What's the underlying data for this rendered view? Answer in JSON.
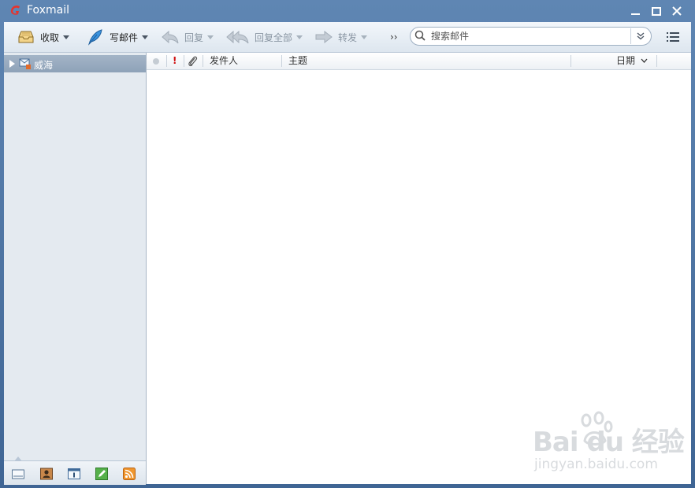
{
  "window": {
    "title": "Foxmail"
  },
  "toolbar": {
    "receive_label": "收取",
    "compose_label": "写邮件",
    "reply_label": "回复",
    "reply_all_label": "回复全部",
    "forward_label": "转发",
    "more_label": "››",
    "search_placeholder": "搜索邮件"
  },
  "sidebar": {
    "account_label": "威海",
    "bottom_icons": [
      "mail-icon",
      "contacts-icon",
      "calendar-icon",
      "notes-icon",
      "rss-icon"
    ]
  },
  "list": {
    "columns": {
      "sender": "发件人",
      "subject": "主题",
      "date": "日期"
    },
    "flag_glyph": "!"
  },
  "watermark": {
    "logo": "Bai du 经验",
    "url": "jingyan.baidu.com"
  },
  "colors": {
    "titlebar": "#4f77a5",
    "sidebar": "#e4eaf0",
    "account_selected": "#96a9bd",
    "flag": "#d01010"
  }
}
